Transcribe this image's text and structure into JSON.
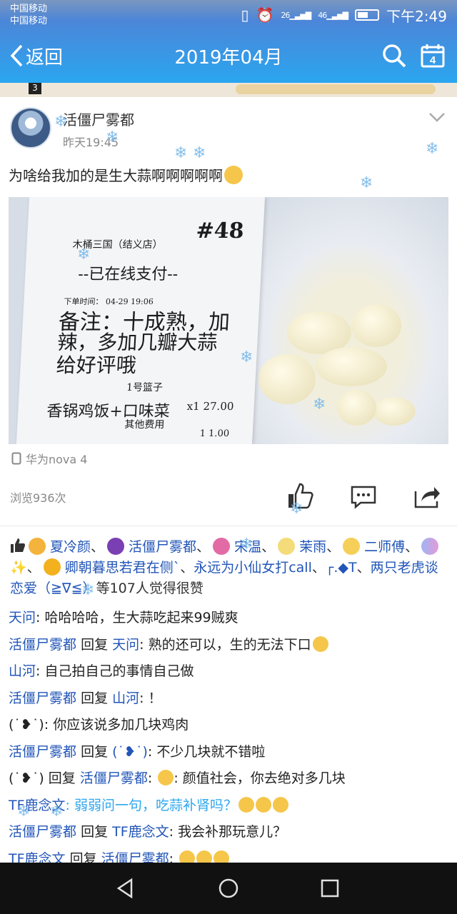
{
  "status_bar": {
    "carrier1": "中国移动",
    "carrier2": "中国移动",
    "network_left": "26",
    "network_right": "46",
    "time": "下午2:49"
  },
  "nav": {
    "back_label": "返回",
    "title": "2019年04月",
    "calendar_day": "4"
  },
  "post": {
    "author": "活僵尸雾都",
    "time": "昨天19:45",
    "text": "为啥给我加的是生大蒜啊啊啊啊啊",
    "device": "华为nova 4",
    "views": "浏览936次"
  },
  "photo": {
    "receipt_number": "#48",
    "shop": "木桶三国（结义店）",
    "paid": "--已在线支付--",
    "order_time": "下单时间： 04-29 19:06",
    "note_line1": "备注：十成熟，加",
    "note_line2": "辣，多加几瓣大蒜",
    "note_line3": "给好评哦",
    "basket": "1号篮子",
    "item": "香锅鸡饭+口味菜",
    "qty_price": "x1   27.00",
    "other_fee": "其他费用",
    "other_price": "1    1.00"
  },
  "likes": {
    "names": [
      "夏冷颜",
      "活僵尸雾都",
      "宋温",
      "茉雨",
      "二师傅",
      "✨",
      "卿朝暮思若君在侧`",
      "永远为小仙女打call",
      "┌.◆T",
      "两只老虎谈恋爱（≧∇≦）"
    ],
    "suffix": "等107人觉得很赞"
  },
  "comments": [
    {
      "name": "天问",
      "reply_to": "",
      "text": ": 哈哈哈哈，生大蒜吃起来99贼爽"
    },
    {
      "name": "活僵尸雾都",
      "reply_to": "天问",
      "text": ": 熟的还可以，生的无法下口"
    },
    {
      "name": "山河",
      "reply_to": "",
      "text": ": 自己拍自己的事情自己做"
    },
    {
      "name": "活僵尸雾都",
      "reply_to": "山河",
      "text": ": ！"
    },
    {
      "name": "(˙❥˙)",
      "reply_to": "",
      "text": ": 你应该说多加几块鸡肉"
    },
    {
      "name": "活僵尸雾都",
      "reply_to": "(˙❥˙)",
      "text": ": 不少几块就不错啦"
    },
    {
      "name": "(˙❥˙)",
      "reply_to": "活僵尸雾都",
      "text": ": 颜值社会，你去绝对多几块"
    },
    {
      "name": "TF鹿念文",
      "reply_to": "",
      "text": ": 弱弱问一句，吃蒜补肾吗？"
    },
    {
      "name": "活僵尸雾都",
      "reply_to": "TF鹿念文",
      "text": ": 我会补那玩意儿？"
    },
    {
      "name": "TF鹿念文",
      "reply_to": "活僵尸雾都",
      "text": ": "
    }
  ],
  "reply_word": "回复",
  "colors": {
    "nav_blue": "#2aa6f0",
    "link_blue": "#2155b8",
    "bottom_bar": "#111111"
  }
}
